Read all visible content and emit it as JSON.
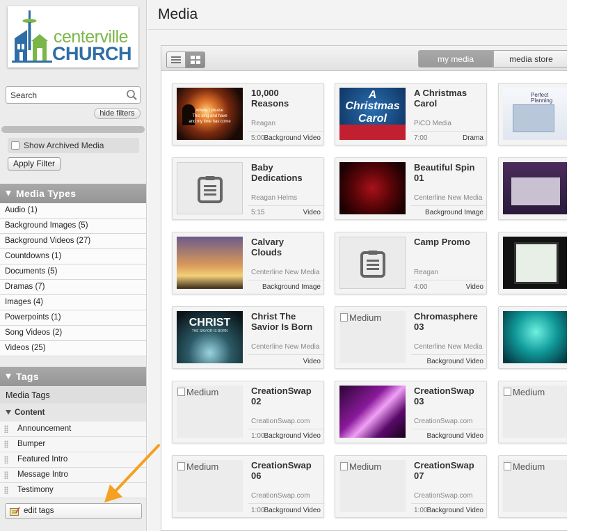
{
  "logo": {
    "text_top": "centerville",
    "text_bottom": "CHURCH"
  },
  "search": {
    "placeholder": "Search"
  },
  "filters": {
    "hide_label": "hide filters",
    "archived_label": "Show Archived Media",
    "apply_label": "Apply Filter"
  },
  "media_types": {
    "header": "Media Types",
    "items": [
      {
        "label": "Audio (1)"
      },
      {
        "label": "Background Images (5)"
      },
      {
        "label": "Background Videos (27)"
      },
      {
        "label": "Countdowns (1)"
      },
      {
        "label": "Documents (5)"
      },
      {
        "label": "Dramas (7)"
      },
      {
        "label": "Images (4)"
      },
      {
        "label": "Powerpoints (1)"
      },
      {
        "label": "Song Videos (2)"
      },
      {
        "label": "Videos (25)"
      }
    ]
  },
  "tags": {
    "header": "Tags",
    "media_tags_label": "Media Tags",
    "content_label": "Content",
    "items": [
      {
        "label": "Announcement"
      },
      {
        "label": "Bumper"
      },
      {
        "label": "Featured Intro"
      },
      {
        "label": "Message Intro"
      },
      {
        "label": "Testimony"
      }
    ],
    "edit_label": "edit tags"
  },
  "main": {
    "title": "Media",
    "tabs": {
      "my_media": "my media",
      "media_store": "media store"
    }
  },
  "cards": [
    {
      "title": "10,000\nReasons",
      "author": "Reagan",
      "duration": "5:00",
      "type": "Background Video",
      "thumb": "sunset-worship",
      "thumb_lines": [
        "where I please",
        "This sing and have",
        "and my time has come"
      ]
    },
    {
      "title": "A Christmas\nCarol",
      "author": "PiCO Media",
      "duration": "7:00",
      "type": "Drama",
      "thumb": "christmas-carol",
      "thumb_lines": [
        "A",
        "Christmas",
        "Carol"
      ]
    },
    {
      "title": "",
      "author": "",
      "duration": "",
      "type": "",
      "thumb": "perfect-planning",
      "thumb_lines": [
        "Perfect",
        "Planning"
      ]
    },
    {
      "title": "Baby\nDedications",
      "author": "Reagan Helms",
      "duration": "5:15",
      "type": "Video",
      "thumb": "document"
    },
    {
      "title": "Beautiful Spin\n01",
      "author": "Centerline New Media",
      "duration": "",
      "type": "Background Image",
      "thumb": "red-bokeh"
    },
    {
      "title": "",
      "author": "",
      "duration": "",
      "type": "",
      "thumb": "website-purple"
    },
    {
      "title": "Calvary\nClouds",
      "author": "Centerline New Media",
      "duration": "",
      "type": "Background Image",
      "thumb": "calvary"
    },
    {
      "title": "Camp Promo",
      "author": "Reagan",
      "duration": "4:00",
      "type": "Video",
      "thumb": "document"
    },
    {
      "title": "",
      "author": "",
      "duration": "",
      "type": "",
      "thumb": "tablet"
    },
    {
      "title": "Christ The\nSavior Is Born",
      "author": "Centerline New Media",
      "duration": "",
      "type": "Video",
      "thumb": "christ-savior",
      "thumb_lines": [
        "CHRIST",
        "THE SAVIOR IS BORN"
      ]
    },
    {
      "title": "Chromasphere\n03",
      "author": "Centerline New Media",
      "duration": "",
      "type": "Background Video",
      "thumb": "broken",
      "alt": "Medium"
    },
    {
      "title": "",
      "author": "",
      "duration": "",
      "type": "",
      "thumb": "teal-city"
    },
    {
      "title": "CreationSwap\n02",
      "author": "CreationSwap.com",
      "duration": "1:00",
      "type": "Background Video",
      "thumb": "broken",
      "alt": "Medium"
    },
    {
      "title": "CreationSwap\n03",
      "author": "CreationSwap.com",
      "duration": "",
      "type": "Background Video",
      "thumb": "purple-light"
    },
    {
      "title": "",
      "author": "",
      "duration": "",
      "type": "",
      "thumb": "broken",
      "alt": "Medium"
    },
    {
      "title": "CreationSwap\n06",
      "author": "CreationSwap.com",
      "duration": "1:00",
      "type": "Background Video",
      "thumb": "broken",
      "alt": "Medium"
    },
    {
      "title": "CreationSwap\n07",
      "author": "CreationSwap.com",
      "duration": "1:00",
      "type": "Background Video",
      "thumb": "broken",
      "alt": "Medium"
    },
    {
      "title": "",
      "author": "",
      "duration": "",
      "type": "",
      "thumb": "broken",
      "alt": "Medium"
    }
  ],
  "colors": {
    "logo_green": "#7ab648",
    "logo_blue": "#2e6ea6",
    "annotation_arrow": "#f5a020"
  }
}
